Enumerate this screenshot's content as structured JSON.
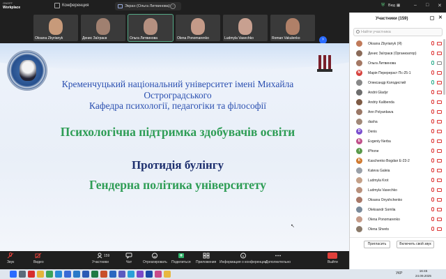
{
  "topbar": {
    "logo_line1": "ONOFF",
    "logo_line2": "Workplace",
    "conference_tab": "Конференция",
    "screen_tab": "Экран (Ольга Литвинова)",
    "view_label": "Вид"
  },
  "thumbnails": [
    {
      "name": "Oksana Zbyrianyk",
      "face": "#c79a7a"
    },
    {
      "name": "Денис Заїграєв",
      "face": "#a08070"
    },
    {
      "name": "Ольга Литвинова",
      "face": "#b59080"
    },
    {
      "name": "Olena Ponomarenko",
      "face": "#c49a88"
    },
    {
      "name": "Ludmyla Vasechko",
      "face": "#c8a090"
    },
    {
      "name": "Roman Vakulenko",
      "face": "#b08068"
    }
  ],
  "slide": {
    "university": "Кременчуцький національний університет імені Михайла Остроградського",
    "department": "Кафедра психології, педагогіки та філософії",
    "title": "Психологічна підтримка здобувачів освіти",
    "line_bullying": "Протидія булінгу",
    "line_gender": "Гендерна політика університету"
  },
  "panel": {
    "title": "Участники (159)",
    "search_placeholder": "Найти участника",
    "participants": [
      {
        "name": "Oksana Zbyrianyk (Я)",
        "initial": "",
        "color": "#c07a5a",
        "mic": "off",
        "cam": "off"
      },
      {
        "name": "Денис Заїграєв (Организатор)",
        "initial": "",
        "color": "#8a6a58",
        "mic": "off",
        "cam": "off"
      },
      {
        "name": "Ольга Литвинова",
        "initial": "",
        "color": "#a47864",
        "mic": "on",
        "cam": "on"
      },
      {
        "name": "Марія Перерерзєт Пс-25-1",
        "initial": "M",
        "color": "#d6403c",
        "mic": "off",
        "cam": "off"
      },
      {
        "name": "Олександр Колодистий",
        "initial": "",
        "color": "#888888",
        "mic": "on",
        "cam": "off"
      },
      {
        "name": "Andrii Gladyr",
        "initial": "",
        "color": "#6d6d6d",
        "mic": "off",
        "cam": "off"
      },
      {
        "name": "Andriy Kalibenda",
        "initial": "",
        "color": "#7d5a44",
        "mic": "off",
        "cam": "off"
      },
      {
        "name": "Ann Polyanbava",
        "initial": "",
        "color": "#9a7766",
        "mic": "off",
        "cam": "off"
      },
      {
        "name": "dasha",
        "initial": "",
        "color": "#a08878",
        "mic": "off",
        "cam": "off"
      },
      {
        "name": "Denis",
        "initial": "D",
        "color": "#7b4fcf",
        "mic": "off",
        "cam": "off"
      },
      {
        "name": "Evgeniy Nerba",
        "initial": "E",
        "color": "#c0508a",
        "mic": "off",
        "cam": "off"
      },
      {
        "name": "iPhone",
        "initial": "i",
        "color": "#5a9a4a",
        "mic": "off",
        "cam": "off"
      },
      {
        "name": "Kaschenko Bogdan Е-23-2",
        "initial": "K",
        "color": "#d07a30",
        "mic": "off",
        "cam": "off"
      },
      {
        "name": "Kateva Galeia",
        "initial": "",
        "color": "#9aa0a8",
        "mic": "off",
        "cam": "off"
      },
      {
        "name": "Ludmyla Krot",
        "initial": "",
        "color": "#c4a088",
        "mic": "off",
        "cam": "off"
      },
      {
        "name": "Ludmyla Vasechko",
        "initial": "",
        "color": "#b8907c",
        "mic": "off",
        "cam": "off"
      },
      {
        "name": "Oksana Onyshchenko",
        "initial": "",
        "color": "#a87868",
        "mic": "off",
        "cam": "off"
      },
      {
        "name": "Oleksandr Somlia",
        "initial": "",
        "color": "#7a8a9a",
        "mic": "off",
        "cam": "off"
      },
      {
        "name": "Olena Ponomarenko",
        "initial": "",
        "color": "#c49a88",
        "mic": "off",
        "cam": "off"
      },
      {
        "name": "Olena Shvets",
        "initial": "",
        "color": "#8a7a6a",
        "mic": "off",
        "cam": "off"
      }
    ],
    "invite_button": "Пригласить",
    "mute_self_button": "Включить свой звук"
  },
  "toolbar": {
    "sound": "Звук",
    "video": "Видео",
    "participants": "Участники",
    "participants_count": "159",
    "chat": "Чат",
    "reactions": "Отреагировать",
    "share": "Поделиться",
    "apps": "Приложения",
    "info": "Информация о конференции",
    "more": "Дополнительно",
    "exit": "Выйти"
  },
  "taskbar": {
    "lang": "УКР",
    "time": "16:45",
    "date": "24.09.2025",
    "icons": [
      {
        "name": "windows-start-icon",
        "color": "#2a6bff"
      },
      {
        "name": "search-icon",
        "color": "#5a6a7a"
      },
      {
        "name": "opera-icon",
        "color": "#d62d2d"
      },
      {
        "name": "explorer-icon",
        "color": "#e3b43a"
      },
      {
        "name": "chrome-icon",
        "color": "#3aa35a"
      },
      {
        "name": "edge-icon",
        "color": "#2a8ad6"
      },
      {
        "name": "store-icon",
        "color": "#3a6ad6"
      },
      {
        "name": "mail-icon",
        "color": "#2a7ac8"
      },
      {
        "name": "word-icon",
        "color": "#2b5bb5"
      },
      {
        "name": "excel-icon",
        "color": "#1e7a44"
      },
      {
        "name": "powerpoint-icon",
        "color": "#c8502a"
      },
      {
        "name": "outlook-icon",
        "color": "#2a68c0"
      },
      {
        "name": "teams-icon",
        "color": "#5a5ac0"
      },
      {
        "name": "telegram-icon",
        "color": "#2aa0d8"
      },
      {
        "name": "viber-icon",
        "color": "#7a4ac8"
      },
      {
        "name": "onoff-icon",
        "color": "#1a4aa8"
      },
      {
        "name": "photos-icon",
        "color": "#c84a8a"
      },
      {
        "name": "folder-icon",
        "color": "#e8b840"
      }
    ]
  }
}
